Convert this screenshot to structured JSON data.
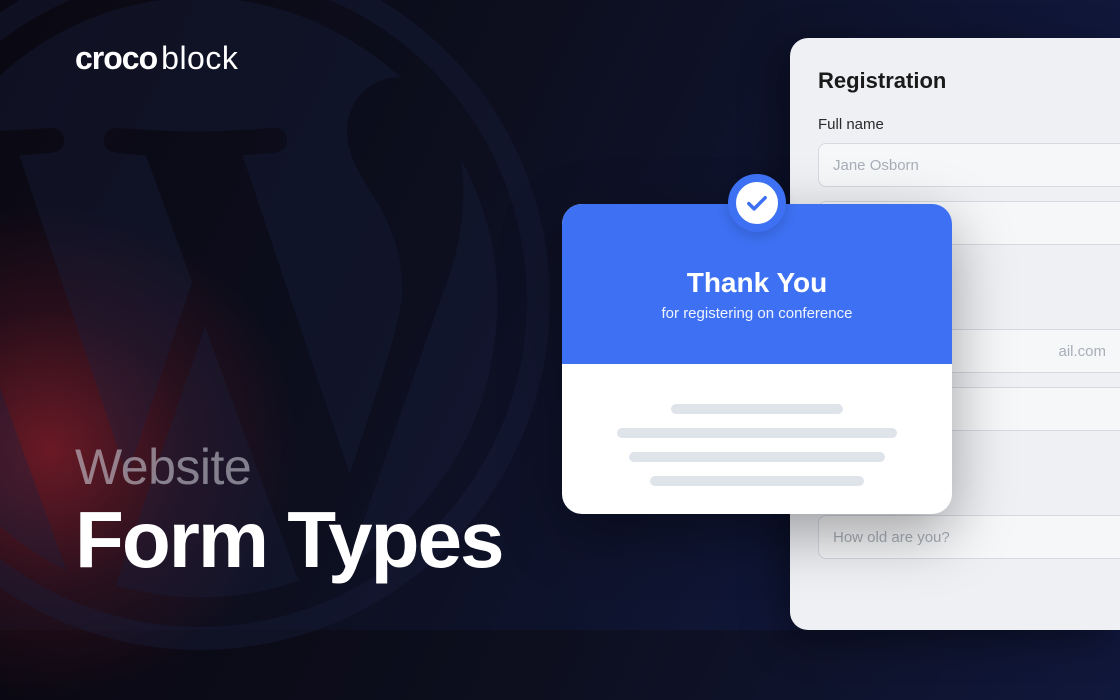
{
  "brand": {
    "part1": "croco",
    "part2": "block"
  },
  "title": {
    "line1": "Website",
    "line2": "Form Types"
  },
  "registration": {
    "heading": "Registration",
    "field1_label": "Full name",
    "field1_placeholder": "Jane Osborn",
    "field3_partial": "ail.com",
    "field5_placeholder": "How old are you?"
  },
  "thanks": {
    "title": "Thank You",
    "subtitle": "for registering on conference"
  },
  "colors": {
    "accent_blue": "#3d70f2",
    "bg_dark": "#0d0f1f"
  }
}
